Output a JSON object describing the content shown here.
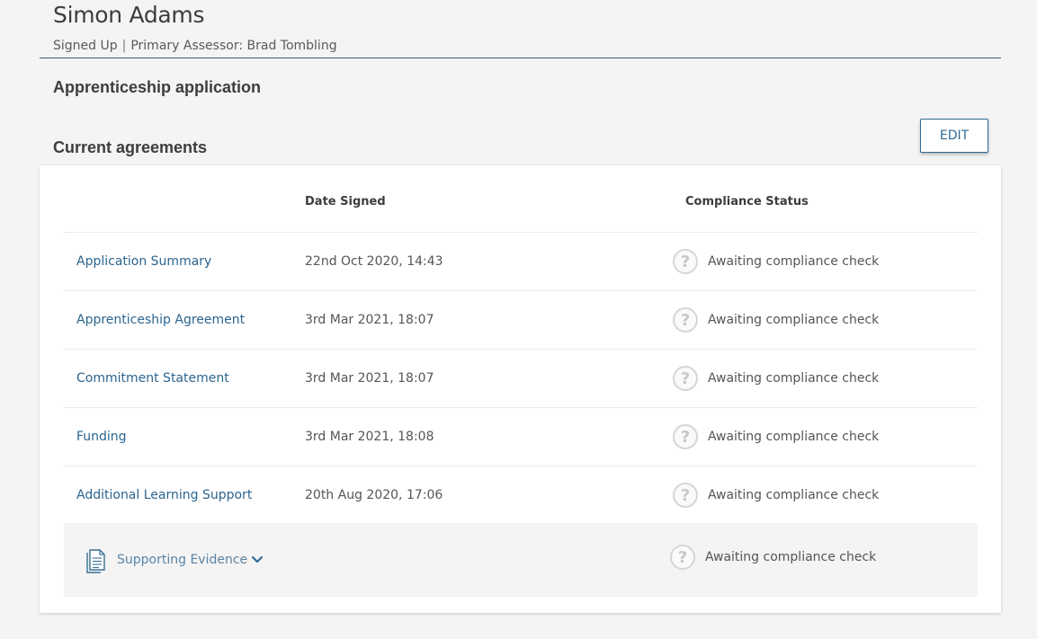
{
  "learner": {
    "name": "Simon Adams",
    "status": "Signed Up",
    "separator": "|",
    "assessor": "Primary Assessor: Brad Tombling"
  },
  "sections": {
    "application_title": "Apprenticeship application",
    "agreements_title": "Current agreements"
  },
  "toolbar": {
    "edit_label": "EDIT"
  },
  "table": {
    "columns": {
      "date": "Date Signed",
      "status": "Compliance Status"
    },
    "rows": [
      {
        "name": "Application Summary",
        "date": "22nd Oct 2020, 14:43",
        "status": "Awaiting compliance check"
      },
      {
        "name": "Apprenticeship Agreement",
        "date": "3rd Mar 2021, 18:07",
        "status": "Awaiting compliance check"
      },
      {
        "name": "Commitment Statement",
        "date": "3rd Mar 2021, 18:07",
        "status": "Awaiting compliance check"
      },
      {
        "name": "Funding",
        "date": "3rd Mar 2021, 18:08",
        "status": "Awaiting compliance check"
      },
      {
        "name": "Additional Learning Support",
        "date": "20th Aug 2020, 17:06",
        "status": "Awaiting compliance check"
      }
    ]
  },
  "evidence": {
    "label": "Supporting Evidence",
    "status": "Awaiting compliance check"
  },
  "icons": {
    "status_glyph": "?",
    "status_icon": "question-circle-icon",
    "document_icon": "document-icon",
    "chevron_icon": "chevron-down-icon"
  },
  "colors": {
    "link": "#2b6590",
    "accent": "#2f6c96",
    "header_rule": "#2f5f7a",
    "background": "#f4f4f4"
  }
}
